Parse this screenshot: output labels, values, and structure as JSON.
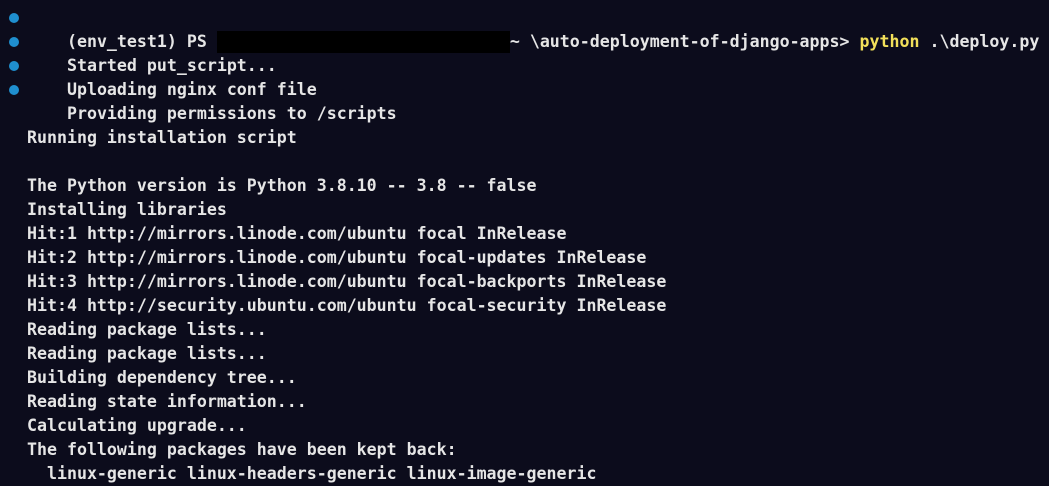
{
  "prompt": {
    "env": "(env_test1) PS",
    "path_tail": "~ \\auto-deployment-of-django-apps>",
    "cmd": "python",
    "arg": ".\\deploy.py"
  },
  "status_lines": [
    "Started put_script...",
    "Uploading nginx conf file",
    "Providing permissions to /scripts"
  ],
  "output": [
    "",
    "Running installation script",
    "",
    "The Python version is Python 3.8.10 -- 3.8 -- false",
    "Installing libraries",
    "Hit:1 http://mirrors.linode.com/ubuntu focal InRelease",
    "Hit:2 http://mirrors.linode.com/ubuntu focal-updates InRelease",
    "Hit:3 http://mirrors.linode.com/ubuntu focal-backports InRelease",
    "Hit:4 http://security.ubuntu.com/ubuntu focal-security InRelease",
    "Reading package lists...",
    "Reading package lists...",
    "Building dependency tree...",
    "Reading state information...",
    "Calculating upgrade...",
    "The following packages have been kept back:",
    "  linux-generic linux-headers-generic linux-image-generic"
  ],
  "colors": {
    "background": "#0c0c1c",
    "text": "#e6e6e6",
    "bullet": "#1f8fcf",
    "command_highlight": "#f2e05a",
    "redaction": "#000000"
  }
}
